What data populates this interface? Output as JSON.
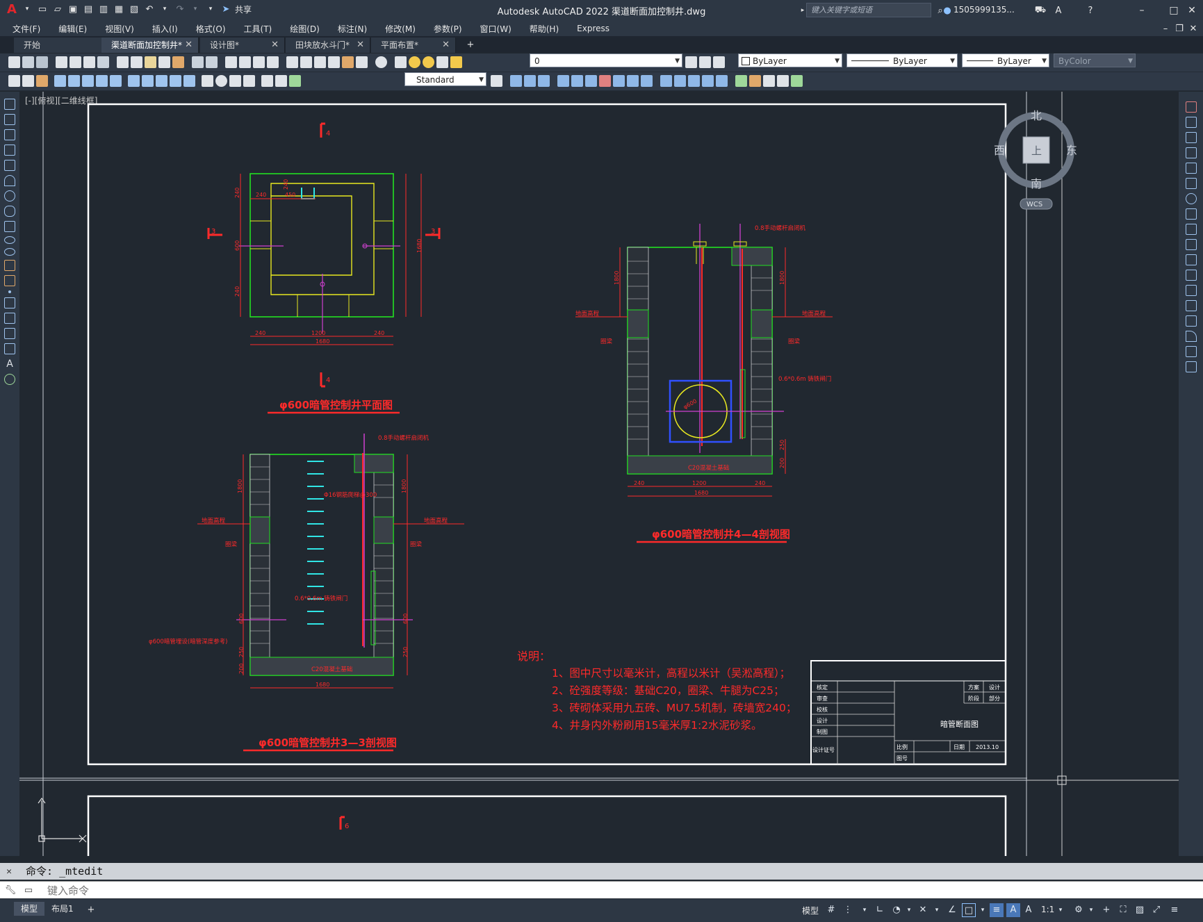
{
  "titlebar": {
    "app_title": "Autodesk AutoCAD 2022    渠道断面加控制井.dwg",
    "share_label": "共享",
    "search_placeholder": "键入关键字或短语",
    "user_name": "1505999135..."
  },
  "menu": [
    "文件(F)",
    "编辑(E)",
    "视图(V)",
    "插入(I)",
    "格式(O)",
    "工具(T)",
    "绘图(D)",
    "标注(N)",
    "修改(M)",
    "参数(P)",
    "窗口(W)",
    "帮助(H)",
    "Express"
  ],
  "tabs": [
    {
      "label": "开始"
    },
    {
      "label": "渠道断面加控制井*"
    },
    {
      "label": "设计图*"
    },
    {
      "label": "田块放水斗门*"
    },
    {
      "label": "平面布置*"
    }
  ],
  "toolbar": {
    "layer_value": "0",
    "color_value": "ByLayer",
    "linetype_value": "ByLayer",
    "lineweight_value": "ByLayer",
    "plotstyle_value": "ByColor",
    "dimstyle_value": "Standard"
  },
  "viewport": {
    "label": "[-][俯视][二维线框]"
  },
  "viewcube": {
    "north": "北",
    "south": "南",
    "east": "东",
    "west": "西",
    "face": "上",
    "wcs": "WCS"
  },
  "drawing": {
    "plan_title": "φ600暗管控制井平面图",
    "section33_title": "φ600暗管控制井3—3剖视图",
    "section44_title": "φ600暗管控制井4—4剖视图",
    "section_mark_4": "4",
    "section_mark_3": "3",
    "section_mark_6": "6",
    "dims": {
      "d240": "240",
      "d450": "450",
      "d1200": "1200",
      "d1680": "1680",
      "d600": "600",
      "d1800": "1800",
      "d250": "250",
      "d200": "200",
      "d20": "20"
    },
    "labels": {
      "hand_gate": "0.8手动螺杆启闭机",
      "ground": "地面高程",
      "ring_beam": "圈梁",
      "gate": "0.6*0.6m 铸铁闸门",
      "base": "C20混凝土基础",
      "ladder": "Φ16钢筋爬梯@300",
      "pipe_note": "φ600暗管埋设(暗管深度参考)",
      "pipe_dia": "φ600"
    },
    "notes_title": "说明：",
    "notes": [
      "1、图中尺寸以毫米计，高程以米计（吴淞高程）；",
      "2、砼强度等级：基础C20，圈梁、牛腿为C25；",
      "3、砖砌体采用九五砖、MU7.5机制，砖墙宽240；",
      "4、井身内外粉刷用15毫米厚1:2水泥砂浆。"
    ],
    "titleblock": {
      "r1": "核定",
      "r2": "审查",
      "r3": "校核",
      "r4": "设计",
      "r5": "制图",
      "r6": "设计证号",
      "c_fangan": "方案",
      "c_sheji": "设计",
      "c_jieduan": "阶段",
      "c_bufen": "部分",
      "drawing_name": "暗管断面图",
      "scale_label": "比例",
      "date_label": "日期",
      "date_value": "2013.10",
      "sheet_label": "图号"
    }
  },
  "command": {
    "history": "命令: _mtedit",
    "placeholder": "键入命令"
  },
  "statusbar": {
    "tab_model": "模型",
    "tab_layout1": "布局1",
    "model_label": "模型",
    "scale": "1:1"
  }
}
